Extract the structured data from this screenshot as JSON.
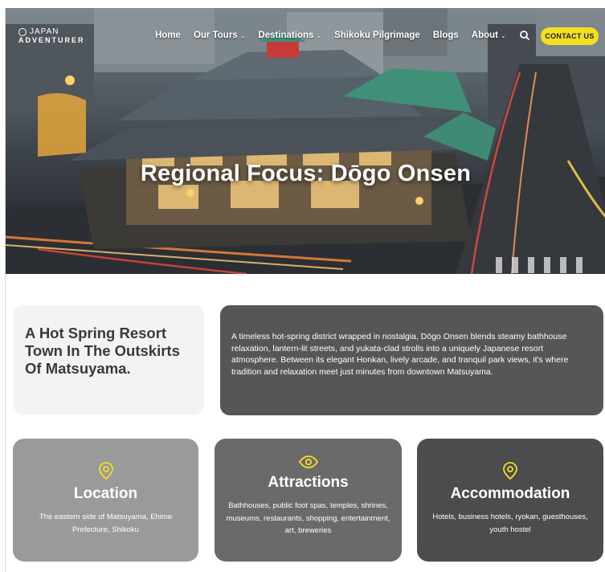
{
  "colors": {
    "accent_yellow": "#f3df1e",
    "card_light": "#9a9a9a",
    "card_mid": "#6a6a6b",
    "card_dark": "#4b4c4d",
    "intro_dark": "#555657"
  },
  "header": {
    "logo_line1": "JAPAN",
    "logo_line2": "ADVENTURER",
    "nav": [
      {
        "label": "Home",
        "has_dropdown": false
      },
      {
        "label": "Our Tours",
        "has_dropdown": true
      },
      {
        "label": "Destinations",
        "has_dropdown": true
      },
      {
        "label": "Shikoku Pilgrimage",
        "has_dropdown": false
      },
      {
        "label": "Blogs",
        "has_dropdown": false
      },
      {
        "label": "About",
        "has_dropdown": true
      }
    ],
    "search_icon": "search-icon",
    "contact_label": "CONTACT US"
  },
  "hero": {
    "title": "Regional Focus: Dōgo Onsen"
  },
  "intro": {
    "heading": "A Hot Spring Resort Town In The Outskirts Of Matsuyama.",
    "body": "A timeless hot-spring district wrapped in nostalgia, Dōgo Onsen blends steamy bathhouse relaxation, lantern-lit streets, and yukata-clad strolls into a uniquely Japanese resort atmosphere. Between its elegant Honkan, lively arcade, and tranquil park views, it's where tradition and relaxation meet just minutes from downtown Matsuyama."
  },
  "cards": [
    {
      "icon": "location-pin-icon",
      "title": "Location",
      "text": "The eastern side of Matsuyama, Ehime Prefecture, Shikoku"
    },
    {
      "icon": "eye-icon",
      "title": "Attractions",
      "text": "Bathhouses, public foot spas, temples, shrines, museums, restaurants, shopping, entertainment, art, breweries"
    },
    {
      "icon": "location-pin-icon",
      "title": "Accommodation",
      "text": "Hotels, business hotels, ryokan, guesthouses, youth hostel"
    }
  ]
}
